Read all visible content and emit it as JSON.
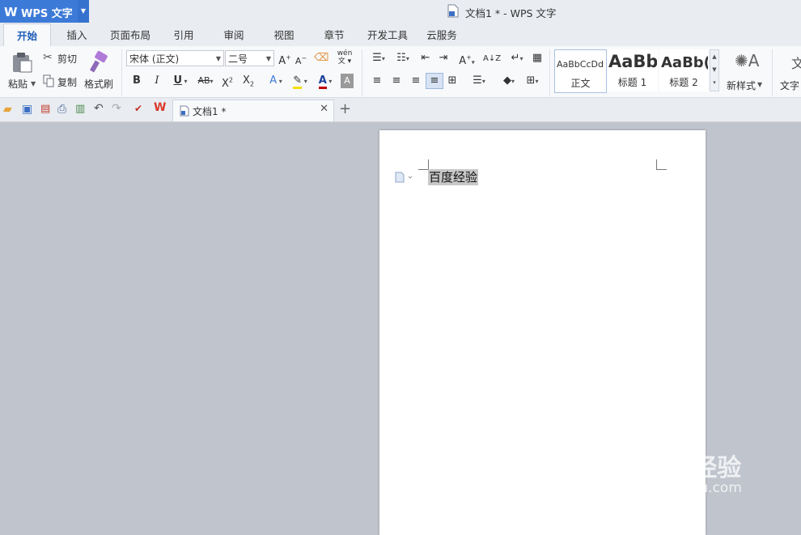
{
  "app": {
    "name": "WPS 文字",
    "logo": "W"
  },
  "window": {
    "title": "文档1 * - WPS 文字"
  },
  "menu_tabs": [
    {
      "label": "开始",
      "active": true
    },
    {
      "label": "插入"
    },
    {
      "label": "页面布局"
    },
    {
      "label": "引用"
    },
    {
      "label": "审阅"
    },
    {
      "label": "视图"
    },
    {
      "label": "章节"
    },
    {
      "label": "开发工具"
    },
    {
      "label": "云服务"
    }
  ],
  "ribbon": {
    "paste": "粘贴",
    "cut": "剪切",
    "copy": "复制",
    "format_painter": "格式刷",
    "font_name": "宋体 (正文)",
    "font_size": "二号",
    "styles": [
      {
        "sample": "AaBbCcDd",
        "name": "正文"
      },
      {
        "sample": "AaBb",
        "name": "标题 1"
      },
      {
        "sample": "AaBb(",
        "name": "标题 2"
      }
    ],
    "new_style": "新样式",
    "text_tools": "文字"
  },
  "doc_tab": {
    "label": "文档1 *"
  },
  "document": {
    "text": "百度经验"
  },
  "watermark": {
    "brand": "Baidu经验",
    "url": "jingyan.baidu.com"
  }
}
